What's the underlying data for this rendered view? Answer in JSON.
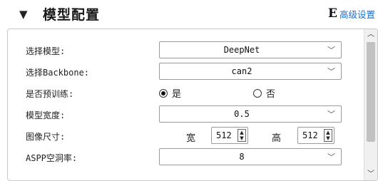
{
  "header": {
    "title": "模型配置",
    "advanced_label": "高级设置",
    "advanced_icon_glyph": "E",
    "link_color": "#1a6fd1"
  },
  "form": {
    "model": {
      "label": "选择模型:",
      "value": "DeepNet"
    },
    "backbone": {
      "label": "选择Backbone:",
      "value": "can2"
    },
    "pretrain": {
      "label": "是否预训练:",
      "option_yes": "是",
      "option_no": "否",
      "selected": "是"
    },
    "width": {
      "label": "模型宽度:",
      "value": "0.5"
    },
    "image_size": {
      "label": "图像尺寸:",
      "width_label": "宽",
      "width_value": "512",
      "height_label": "高",
      "height_value": "512"
    },
    "aspp": {
      "label": "ASPP空洞率:",
      "value": "8"
    }
  }
}
